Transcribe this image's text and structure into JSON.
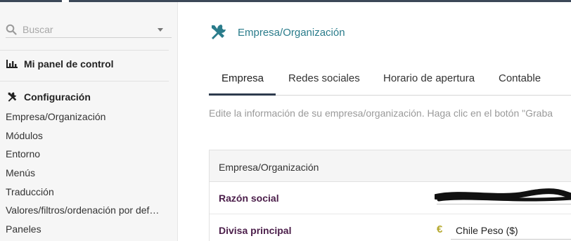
{
  "search": {
    "placeholder": "Buscar"
  },
  "sidebar": {
    "dashboard_label": "Mi panel de control",
    "config_label": "Configuración",
    "items": [
      {
        "label": "Empresa/Organización"
      },
      {
        "label": "Módulos"
      },
      {
        "label": "Entorno"
      },
      {
        "label": "Menús"
      },
      {
        "label": "Traducción"
      },
      {
        "label": "Valores/filtros/ordenación por def…"
      },
      {
        "label": "Paneles"
      }
    ]
  },
  "page": {
    "title": "Empresa/Organización",
    "icon": "tools-icon",
    "accent_color": "#2a7c8b"
  },
  "tabs": [
    {
      "label": "Empresa",
      "active": true
    },
    {
      "label": "Redes sociales",
      "active": false
    },
    {
      "label": "Horario de apertura",
      "active": false
    },
    {
      "label": "Contable",
      "active": false
    }
  ],
  "description": "Edite la información de su empresa/organización. Haga clic en el botón \"Graba",
  "form": {
    "section_title": "Empresa/Organización",
    "company_name_label": "Razón social",
    "currency_label": "Divisa principal",
    "currency_symbol": "€",
    "currency_value": "Chile Peso ($)"
  }
}
